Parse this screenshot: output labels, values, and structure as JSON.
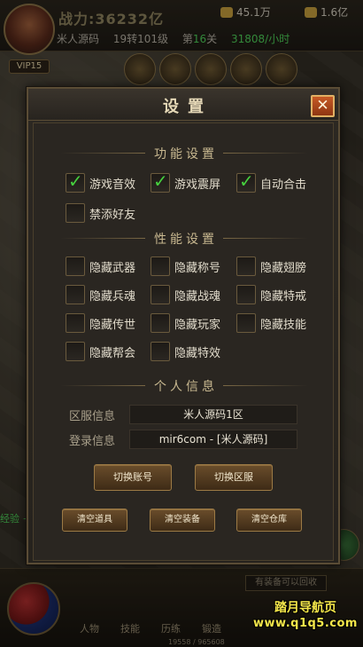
{
  "hud": {
    "power": "战力:36232亿",
    "gold1": "45.1万",
    "gold2": "1.6亿",
    "level_tag": "VIP15",
    "player_name": "米人源码",
    "rebirth": "19转101级",
    "stage_prefix": "第",
    "stage_num": "16",
    "stage_suffix": "关",
    "rate": "31808/小时",
    "exp_gain": "经验 +17",
    "exp_bar_text": "19558 / 965608",
    "recycle_tip": "有装备可以回收",
    "bottom_tabs": [
      "人物",
      "技能",
      "历练",
      "锻造"
    ]
  },
  "watermark": {
    "line1": "踏月导航页",
    "line2": "www.q1q5.com"
  },
  "dialog": {
    "title": "设置",
    "close_label": "✕",
    "section_function": "功能设置",
    "section_performance": "性能设置",
    "section_personal": "个人信息",
    "function_options": [
      {
        "label": "游戏音效",
        "checked": true
      },
      {
        "label": "游戏震屏",
        "checked": true
      },
      {
        "label": "自动合击",
        "checked": true
      },
      {
        "label": "禁添好友",
        "checked": false
      }
    ],
    "performance_options": [
      {
        "label": "隐藏武器",
        "checked": false
      },
      {
        "label": "隐藏称号",
        "checked": false
      },
      {
        "label": "隐藏翅膀",
        "checked": false
      },
      {
        "label": "隐藏兵魂",
        "checked": false
      },
      {
        "label": "隐藏战魂",
        "checked": false
      },
      {
        "label": "隐藏特戒",
        "checked": false
      },
      {
        "label": "隐藏传世",
        "checked": false
      },
      {
        "label": "隐藏玩家",
        "checked": false
      },
      {
        "label": "隐藏技能",
        "checked": false
      },
      {
        "label": "隐藏帮会",
        "checked": false
      },
      {
        "label": "隐藏特效",
        "checked": false
      }
    ],
    "server_label": "区服信息",
    "server_value": "米人源码1区",
    "login_label": "登录信息",
    "login_value": "mir6com - [米人源码]",
    "btn_switch_account": "切换账号",
    "btn_switch_server": "切换区服",
    "btn_clear_items": "清空道具",
    "btn_clear_equip": "清空装备",
    "btn_clear_storage": "清空仓库"
  },
  "colors": {
    "check_green": "#46d03e",
    "close_orange": "#b84a1d",
    "title_gold": "#e4d7b6"
  }
}
